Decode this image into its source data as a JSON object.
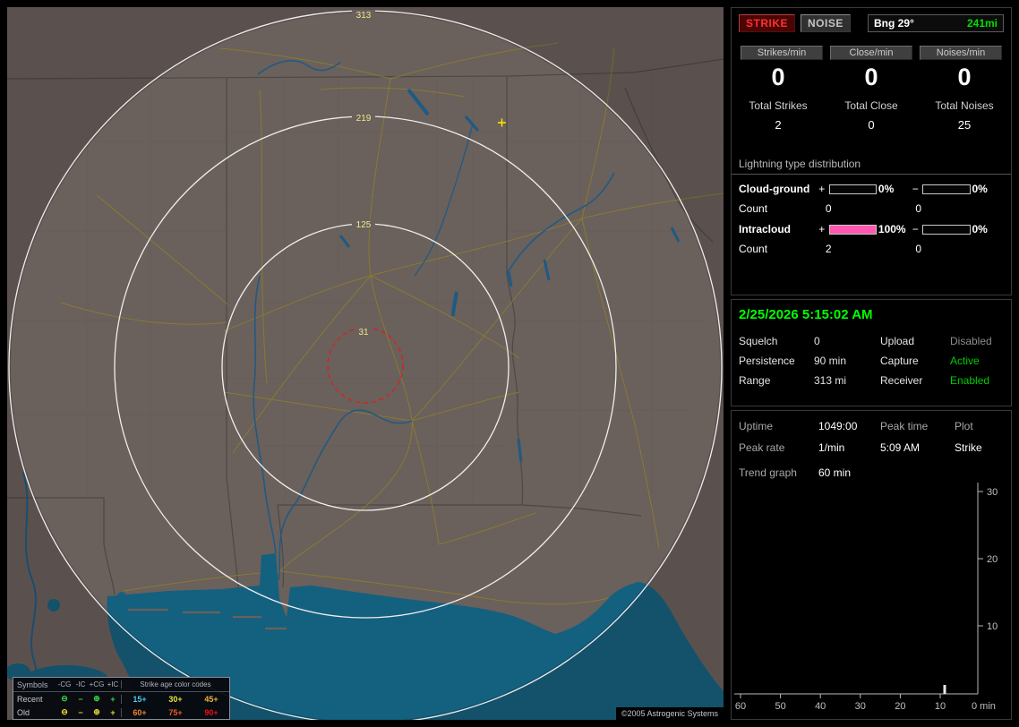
{
  "colors": {
    "accent_green": "#00e000",
    "datetime_green": "#00ff00",
    "intracloud_pink": "#ff58b0",
    "strike_red": "#ff3030",
    "land": "#6a605c",
    "water": "#14607f"
  },
  "map": {
    "range_labels": [
      "313",
      "219",
      "125",
      "31"
    ],
    "copyright": "©2005 Astrogenic Systems",
    "legend": {
      "symbols_header": "Symbols",
      "symbol_cols": [
        "-CG",
        "-IC",
        "+CG",
        "+IC"
      ],
      "age_header": "Strike age color codes",
      "recent_label": "Recent",
      "old_label": "Old",
      "symbols": [
        "⊖",
        "−",
        "⊕",
        "+"
      ],
      "recent_ages": [
        {
          "label": "15+",
          "color": "#49c8f0"
        },
        {
          "label": "30+",
          "color": "#e8e438"
        },
        {
          "label": "45+",
          "color": "#f0b038"
        }
      ],
      "old_ages": [
        {
          "label": "60+",
          "color": "#f08428"
        },
        {
          "label": "75+",
          "color": "#f05818"
        },
        {
          "label": "90+",
          "color": "#f01010"
        }
      ]
    }
  },
  "panel": {
    "strike_button": "STRIKE",
    "noise_button": "NOISE",
    "bearing_label": "Bng 29°",
    "bearing_value": "241mi",
    "rates": [
      {
        "label": "Strikes/min",
        "value": "0"
      },
      {
        "label": "Close/min",
        "value": "0"
      },
      {
        "label": "Noises/min",
        "value": "0"
      }
    ],
    "totals": [
      {
        "label": "Total Strikes",
        "value": "2"
      },
      {
        "label": "Total Close",
        "value": "0"
      },
      {
        "label": "Total Noises",
        "value": "25"
      }
    ],
    "distribution": {
      "title": "Lightning type distribution",
      "plus_sign": "+",
      "minus_sign": "−",
      "rows": [
        {
          "label": "Cloud-ground",
          "pos_pct": "0%",
          "pos_fill": 0,
          "neg_pct": "0%",
          "neg_fill": 0,
          "count_label": "Count",
          "pos_count": "0",
          "neg_count": "0"
        },
        {
          "label": "Intracloud",
          "pos_pct": "100%",
          "pos_fill": 100,
          "neg_pct": "0%",
          "neg_fill": 0,
          "count_label": "Count",
          "pos_count": "2",
          "neg_count": "0"
        }
      ]
    },
    "datetime": "2/25/2026 5:15:02 AM",
    "status_rows": [
      {
        "label": "Squelch",
        "value": "0",
        "label2": "Upload",
        "value2": "Disabled"
      },
      {
        "label": "Persistence",
        "value": "90 min",
        "label2": "Capture",
        "value2": "Active"
      },
      {
        "label": "Range",
        "value": "313 mi",
        "label2": "Receiver",
        "value2": "Enabled"
      }
    ],
    "stats": {
      "uptime_label": "Uptime",
      "uptime_value": "1049:00",
      "peak_time_label": "Peak time",
      "plot_label": "Plot",
      "peak_rate_label": "Peak rate",
      "peak_rate_value": "1/min",
      "peak_time_value": "5:09 AM",
      "plot_value": "Strike",
      "trend_label": "Trend graph",
      "trend_value": "60 min"
    }
  },
  "chart_data": {
    "type": "bar",
    "title": "Strike trend graph (last 60 min)",
    "xlabel": "min",
    "x_ticks": [
      "60",
      "50",
      "40",
      "30",
      "20",
      "10"
    ],
    "x_end_label": "0 min",
    "y_ticks": [
      "30",
      "20",
      "10"
    ],
    "ylim": [
      0,
      30
    ],
    "legend_position": "none",
    "series": [
      {
        "name": "Strike",
        "points": [
          {
            "minutes_ago": 8,
            "value": 1
          }
        ],
        "baseline": 0
      }
    ]
  }
}
